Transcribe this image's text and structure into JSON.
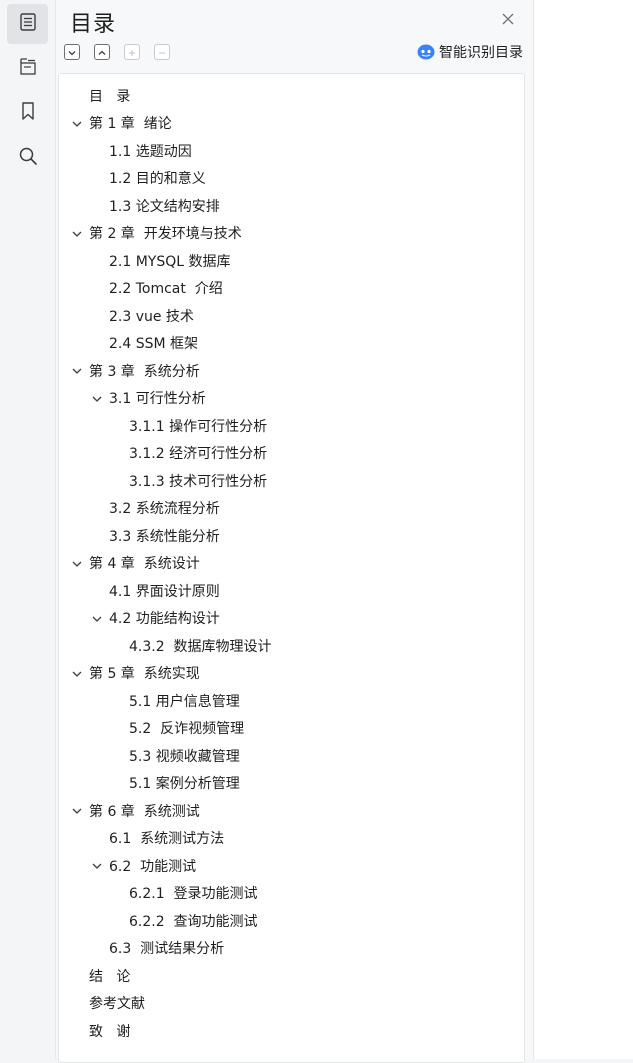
{
  "panel": {
    "title": "目录",
    "smart_toc_label": "智能识别目录"
  },
  "rail": {
    "items": [
      {
        "icon": "outline-icon",
        "active": true
      },
      {
        "icon": "thumbnail-icon",
        "active": false
      },
      {
        "icon": "bookmark-icon",
        "active": false
      },
      {
        "icon": "search-icon",
        "active": false
      }
    ]
  },
  "toolbar": {
    "buttons": [
      "expand-all",
      "collapse-all",
      "add-entry",
      "remove-entry"
    ]
  },
  "toc": [
    {
      "label": "目   录",
      "level": 0,
      "expandable": false
    },
    {
      "label": "第 1 章  绪论",
      "level": 0,
      "expandable": true
    },
    {
      "label": "1.1 选题动因",
      "level": 1,
      "expandable": false
    },
    {
      "label": "1.2 目的和意义",
      "level": 1,
      "expandable": false
    },
    {
      "label": "1.3 论文结构安排",
      "level": 1,
      "expandable": false
    },
    {
      "label": "第 2 章  开发环境与技术",
      "level": 0,
      "expandable": true
    },
    {
      "label": "2.1 MYSQL 数据库",
      "level": 1,
      "expandable": false
    },
    {
      "label": "2.2 Tomcat  介绍",
      "level": 1,
      "expandable": false
    },
    {
      "label": "2.3 vue 技术",
      "level": 1,
      "expandable": false
    },
    {
      "label": "2.4 SSM 框架",
      "level": 1,
      "expandable": false
    },
    {
      "label": "第 3 章  系统分析",
      "level": 0,
      "expandable": true
    },
    {
      "label": "3.1 可行性分析",
      "level": 1,
      "expandable": true
    },
    {
      "label": "3.1.1 操作可行性分析",
      "level": 2,
      "expandable": false
    },
    {
      "label": "3.1.2 经济可行性分析",
      "level": 2,
      "expandable": false
    },
    {
      "label": "3.1.3 技术可行性分析",
      "level": 2,
      "expandable": false
    },
    {
      "label": "3.2 系统流程分析",
      "level": 1,
      "expandable": false
    },
    {
      "label": "3.3 系统性能分析",
      "level": 1,
      "expandable": false
    },
    {
      "label": "第 4 章  系统设计",
      "level": 0,
      "expandable": true
    },
    {
      "label": "4.1 界面设计原则",
      "level": 1,
      "expandable": false
    },
    {
      "label": "4.2 功能结构设计",
      "level": 1,
      "expandable": true
    },
    {
      "label": "4.3.2  数据库物理设计",
      "level": 2,
      "expandable": false
    },
    {
      "label": "第 5 章  系统实现",
      "level": 0,
      "expandable": true
    },
    {
      "label": "5.1 用户信息管理",
      "level": 2,
      "expandable": false
    },
    {
      "label": "5.2  反诈视频管理",
      "level": 2,
      "expandable": false
    },
    {
      "label": "5.3 视频收藏管理",
      "level": 2,
      "expandable": false
    },
    {
      "label": "5.1 案例分析管理",
      "level": 2,
      "expandable": false
    },
    {
      "label": "第 6 章  系统测试",
      "level": 0,
      "expandable": true
    },
    {
      "label": "6.1  系统测试方法",
      "level": 1,
      "expandable": false
    },
    {
      "label": "6.2  功能测试",
      "level": 1,
      "expandable": true
    },
    {
      "label": "6.2.1  登录功能测试",
      "level": 2,
      "expandable": false
    },
    {
      "label": "6.2.2  查询功能测试",
      "level": 2,
      "expandable": false
    },
    {
      "label": "6.3  测试结果分析",
      "level": 1,
      "expandable": false
    },
    {
      "label": "结   论",
      "level": 0,
      "expandable": false
    },
    {
      "label": "参考文献",
      "level": 0,
      "expandable": false
    },
    {
      "label": "致   谢",
      "level": 0,
      "expandable": false
    }
  ],
  "colors": {
    "accent": "#3b82f6",
    "text": "#1f1f1f",
    "panel_bg": "#f7f8f9",
    "tree_bg": "#ffffff"
  }
}
